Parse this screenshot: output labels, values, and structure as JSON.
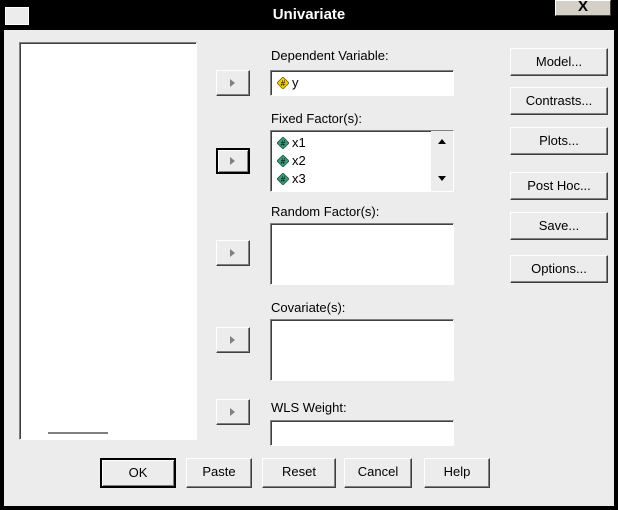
{
  "window": {
    "title": "Univariate",
    "close_glyph": "X"
  },
  "fields": {
    "dependent": {
      "label": "Dependent Variable:",
      "items": [
        "y"
      ]
    },
    "fixed": {
      "label": "Fixed Factor(s):",
      "items": [
        "x1",
        "x2",
        "x3"
      ]
    },
    "random": {
      "label": "Random Factor(s):"
    },
    "covariates": {
      "label": "Covariate(s):"
    },
    "wls": {
      "label": "WLS Weight:"
    }
  },
  "side_buttons": [
    "Model...",
    "Contrasts...",
    "Plots...",
    "Post Hoc...",
    "Save...",
    "Options..."
  ],
  "bottom_buttons": [
    "OK",
    "Paste",
    "Reset",
    "Cancel",
    "Help"
  ],
  "icons": {
    "dependent_variable": "scale-variable-icon",
    "factor_variable": "nominal-variable-icon",
    "arrow": "move-right-arrow-icon",
    "scroll_up": "scroll-up-arrow-icon",
    "scroll_down": "scroll-down-arrow-icon"
  },
  "colors": {
    "face": "#ececec",
    "title_bar": "#000000",
    "dependent_icon": "#f0d000",
    "factor_icon": "#3c9a7a"
  }
}
